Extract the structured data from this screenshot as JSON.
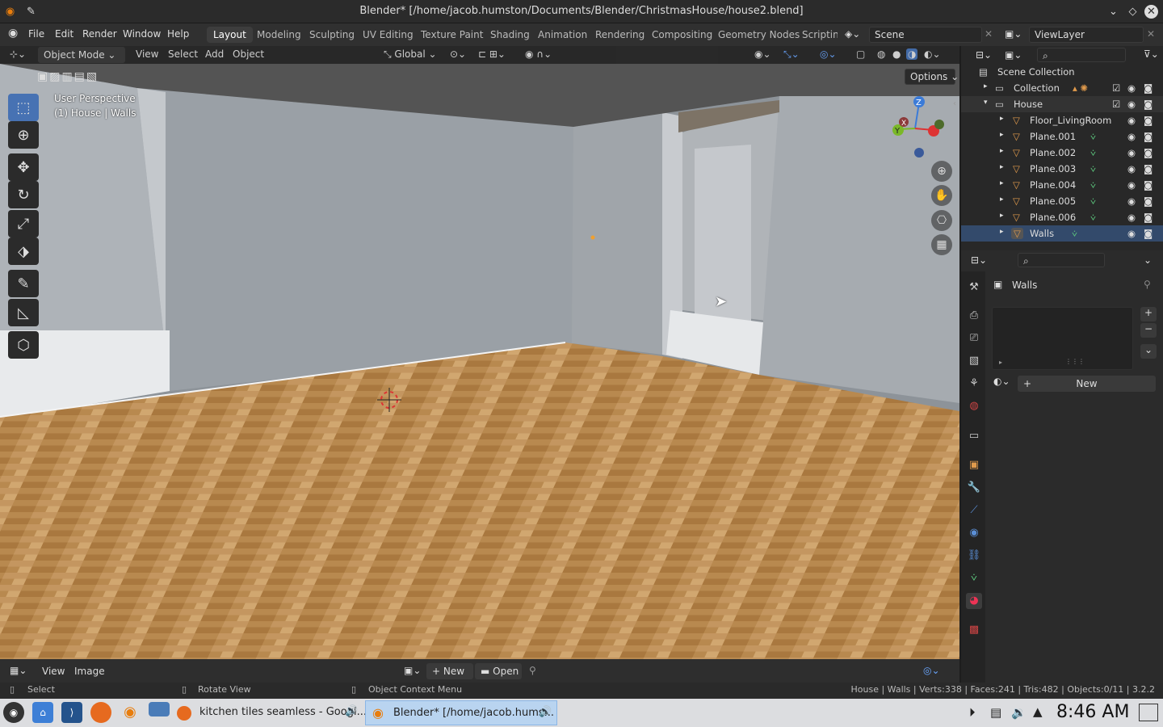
{
  "window": {
    "title": "Blender* [/home/jacob.humston/Documents/Blender/ChristmasHouse/house2.blend]"
  },
  "menu": [
    "File",
    "Edit",
    "Render",
    "Window",
    "Help"
  ],
  "workspaces": [
    "Layout",
    "Modeling",
    "Sculpting",
    "UV Editing",
    "Texture Paint",
    "Shading",
    "Animation",
    "Rendering",
    "Compositing",
    "Geometry Nodes",
    "Scripting"
  ],
  "scene": {
    "scene_name": "Scene",
    "view_layer": "ViewLayer"
  },
  "viewport_header": {
    "mode": "Object Mode",
    "menus": [
      "View",
      "Select",
      "Add",
      "Object"
    ],
    "transform": "Global",
    "options": "Options"
  },
  "viewport": {
    "perspective": "User Perspective",
    "context": "(1) House | Walls",
    "gizmo": {
      "x": "X",
      "y": "Y",
      "z": "Z"
    },
    "colors": {
      "wall": "#9aa0a6",
      "floor": "#b8894f",
      "accent": "#4772b3"
    }
  },
  "outliner": {
    "root": "Scene Collection",
    "rows": [
      "Collection",
      "House",
      "Floor_LivingRoom",
      "Plane.001",
      "Plane.002",
      "Plane.003",
      "Plane.004",
      "Plane.005",
      "Plane.006",
      "Walls"
    ]
  },
  "properties": {
    "object_name": "Walls",
    "new_label": "New"
  },
  "image_editor": {
    "menus": [
      "View",
      "Image"
    ],
    "new_label": "New",
    "open_label": "Open"
  },
  "statusbar": {
    "select": "Select",
    "rotate": "Rotate View",
    "context_menu": "Object Context Menu",
    "stats": "House | Walls | Verts:338 | Faces:241 | Tris:482 | Objects:0/11 | 3.2.2"
  },
  "taskbar": {
    "task1": "kitchen tiles seamless - Googl...",
    "task2": "Blender* [/home/jacob.hums...",
    "clock": "8:46 AM"
  }
}
